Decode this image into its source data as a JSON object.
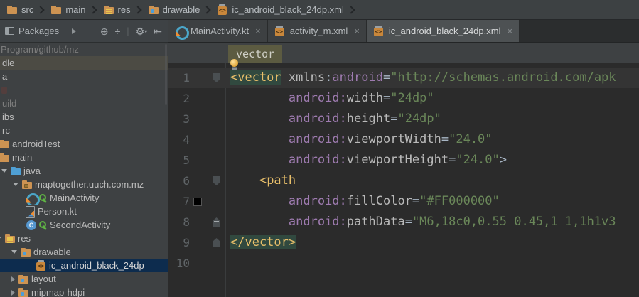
{
  "icons_map": {
    "close": "×",
    "locate": "⊕",
    "collapse_all": "÷",
    "separator": "|",
    "settings": "⚙",
    "dropdown": "▾",
    "hide_panel": "⇤"
  },
  "colors": {
    "selection_bg": "#0d2c4e",
    "hover_row_bg": "#4c4b44",
    "editor_bg": "#2b2b2b",
    "panel_bg": "#3e4143",
    "tag": "#e8bf6a",
    "namespace": "#9e7bb0",
    "attribute": "#bababa",
    "string": "#6a8759",
    "tag_match_bg": "#31493f",
    "breadcrumb_chip_bg": "#5c5b41",
    "line7_color_swatch": "#000000"
  },
  "breadcrumb_bar": {
    "items": [
      {
        "label": "src",
        "icon": "folder"
      },
      {
        "label": "main",
        "icon": "folder"
      },
      {
        "label": "res",
        "icon": "res-folder"
      },
      {
        "label": "drawable",
        "icon": "res-sub-folder"
      },
      {
        "label": "ic_android_black_24dp.xml",
        "icon": "xml-file"
      }
    ]
  },
  "project_panel": {
    "header": {
      "title": "Packages"
    },
    "tree": [
      {
        "label": "Program/github/mz",
        "pad": -2,
        "dim": true
      },
      {
        "label": "dle",
        "pad": 0,
        "state": "hover"
      },
      {
        "label": "a",
        "pad": 0
      },
      {
        "label": "",
        "pad": 0,
        "faint": true
      },
      {
        "label": "uild",
        "pad": 0,
        "dim": true
      },
      {
        "label": "ibs",
        "pad": 0
      },
      {
        "label": "rc",
        "pad": 0
      },
      {
        "label": "androidTest",
        "pad": -2,
        "icon": "folder"
      },
      {
        "label": "main",
        "pad": -2,
        "icon": "folder"
      },
      {
        "label": "java",
        "pad": 2,
        "arrow": "open",
        "icon": "folder-blue"
      },
      {
        "label": "maptogether.uuch.com.mz",
        "pad": 18,
        "arrow": "open",
        "icon": "package"
      },
      {
        "label": "MainActivity",
        "pad": 36,
        "icon": "kotlin-class",
        "badge": "key"
      },
      {
        "label": "Person.kt",
        "pad": 34,
        "icon": "kotlin-file"
      },
      {
        "label": "SecondActivity",
        "pad": 36,
        "icon": "java-class",
        "badge": "key"
      },
      {
        "label": "res",
        "pad": -6,
        "arrow": "open",
        "icon": "res-folder"
      },
      {
        "label": "drawable",
        "pad": 16,
        "arrow": "open",
        "icon": "res-sub-folder"
      },
      {
        "label": "ic_android_black_24dp",
        "pad": 50,
        "icon": "xml-file",
        "state": "selected"
      },
      {
        "label": "layout",
        "pad": 16,
        "arrow": "closed",
        "icon": "res-sub-folder"
      },
      {
        "label": "mipmap-hdpi",
        "pad": 16,
        "arrow": "closed",
        "icon": "res-sub-folder"
      }
    ]
  },
  "tabs": [
    {
      "label": "MainActivity.kt",
      "icon": "kotlin-class",
      "active": false
    },
    {
      "label": "activity_m.xml",
      "icon": "xml-file",
      "active": false
    },
    {
      "label": "ic_android_black_24dp.xml",
      "icon": "xml-file",
      "active": true
    }
  ],
  "editor": {
    "breadcrumb": {
      "tag": "vector"
    },
    "lines": [
      {
        "num": "1",
        "fold": "down",
        "cur": true,
        "caret": true,
        "tokens": [
          [
            "taghl",
            "<vector"
          ],
          [
            "plain",
            " "
          ],
          [
            "attr",
            "xmlns"
          ],
          [
            "plain",
            ":"
          ],
          [
            "ns",
            "android"
          ],
          [
            "plain",
            "="
          ],
          [
            "str",
            "\"http://schemas.android.com/apk"
          ]
        ]
      },
      {
        "num": "2",
        "tokens": [
          [
            "plain",
            "        "
          ],
          [
            "ns",
            "android"
          ],
          [
            "ns",
            ":"
          ],
          [
            "attr",
            "width"
          ],
          [
            "plain",
            "="
          ],
          [
            "str",
            "\"24dp\""
          ]
        ]
      },
      {
        "num": "3",
        "tokens": [
          [
            "plain",
            "        "
          ],
          [
            "ns",
            "android"
          ],
          [
            "ns",
            ":"
          ],
          [
            "attr",
            "height"
          ],
          [
            "plain",
            "="
          ],
          [
            "str",
            "\"24dp\""
          ]
        ]
      },
      {
        "num": "4",
        "tokens": [
          [
            "plain",
            "        "
          ],
          [
            "ns",
            "android"
          ],
          [
            "ns",
            ":"
          ],
          [
            "attr",
            "viewportWidth"
          ],
          [
            "plain",
            "="
          ],
          [
            "str",
            "\"24.0\""
          ]
        ]
      },
      {
        "num": "5",
        "tokens": [
          [
            "plain",
            "        "
          ],
          [
            "ns",
            "android"
          ],
          [
            "ns",
            ":"
          ],
          [
            "attr",
            "viewportHeight"
          ],
          [
            "plain",
            "="
          ],
          [
            "str",
            "\"24.0\""
          ],
          [
            "plain",
            ">"
          ]
        ]
      },
      {
        "num": "6",
        "fold": "down",
        "tokens": [
          [
            "plain",
            "    "
          ],
          [
            "tag",
            "<path"
          ]
        ]
      },
      {
        "num": "7",
        "swatch": "#000000",
        "tokens": [
          [
            "plain",
            "        "
          ],
          [
            "ns",
            "android"
          ],
          [
            "ns",
            ":"
          ],
          [
            "attr",
            "fillColor"
          ],
          [
            "plain",
            "="
          ],
          [
            "str",
            "\"#FF000000\""
          ]
        ]
      },
      {
        "num": "8",
        "fold": "up",
        "tokens": [
          [
            "plain",
            "        "
          ],
          [
            "ns",
            "android"
          ],
          [
            "ns",
            ":"
          ],
          [
            "attr",
            "pathData"
          ],
          [
            "plain",
            "="
          ],
          [
            "str",
            "\"M6,18c0,0.55 0.45,1 1,1h1v3"
          ]
        ]
      },
      {
        "num": "9",
        "fold": "up",
        "tokens": [
          [
            "taghl",
            "</vector>"
          ]
        ]
      },
      {
        "num": "10",
        "tokens": []
      }
    ]
  }
}
